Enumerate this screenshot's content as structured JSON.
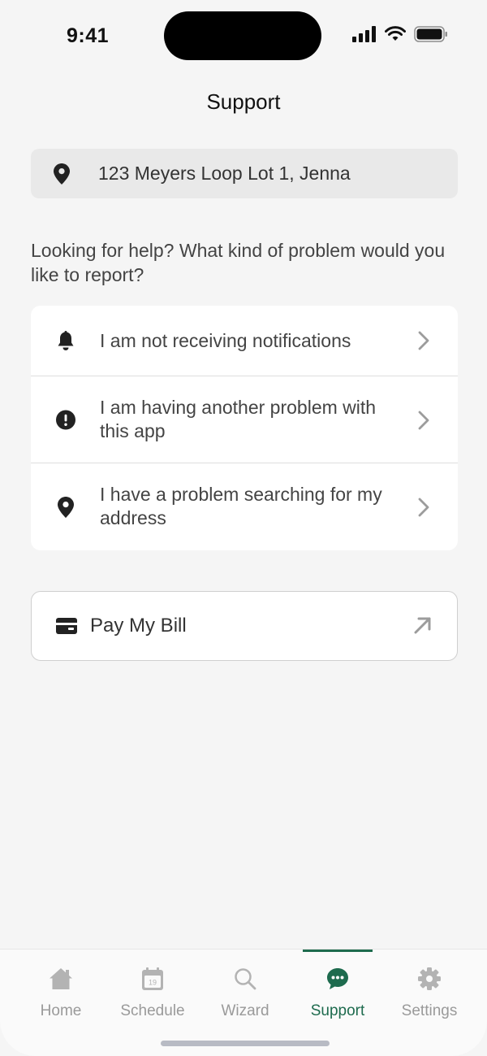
{
  "status_bar": {
    "time": "9:41"
  },
  "header": {
    "title": "Support"
  },
  "address": {
    "text": "123 Meyers Loop Lot 1, Jenna"
  },
  "prompt": "Looking for help? What kind of problem would you like to report?",
  "options": [
    {
      "label": "I am not receiving notifications",
      "icon": "bell-icon"
    },
    {
      "label": "I am having another problem with this app",
      "icon": "alert-circle-icon"
    },
    {
      "label": "I have a problem searching for my address",
      "icon": "map-pin-icon"
    }
  ],
  "pay_bill": {
    "label": "Pay My Bill",
    "icon": "credit-card-icon",
    "action_icon": "external-arrow-icon"
  },
  "tabs": [
    {
      "label": "Home",
      "icon": "home-icon"
    },
    {
      "label": "Schedule",
      "icon": "calendar-icon",
      "calendar_day": "19"
    },
    {
      "label": "Wizard",
      "icon": "search-icon"
    },
    {
      "label": "Support",
      "icon": "chat-bubble-icon",
      "active": true
    },
    {
      "label": "Settings",
      "icon": "gear-icon"
    }
  ],
  "colors": {
    "accent": "#1e6b4e",
    "inactive": "#9a9a9a",
    "background": "#f5f5f5"
  }
}
